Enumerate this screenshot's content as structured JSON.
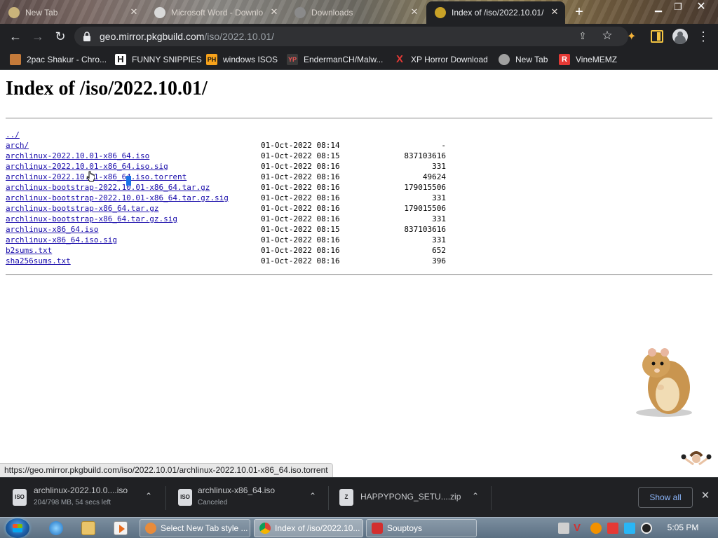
{
  "tabs": [
    {
      "title": "New Tab"
    },
    {
      "title": "Microsoft Word - Downlo"
    },
    {
      "title": "Downloads"
    },
    {
      "title": "Index of /iso/2022.10.01/"
    }
  ],
  "toolbar": {
    "url_host": "geo.mirror.pkgbuild.com",
    "url_path": "/iso/2022.10.01/"
  },
  "bookmarks": [
    {
      "label": "2pac Shakur - Chro...",
      "icon_text": ""
    },
    {
      "label": "FUNNY SNIPPIES",
      "icon_text": "H"
    },
    {
      "label": "windows ISOS",
      "icon_text": "PH"
    },
    {
      "label": "EndermanCH/Malw...",
      "icon_text": "YP"
    },
    {
      "label": "XP Horror Download",
      "icon_text": "X"
    },
    {
      "label": "New Tab",
      "icon_text": ""
    },
    {
      "label": "VineMEMZ",
      "icon_text": "R"
    }
  ],
  "page": {
    "title": "Index of /iso/2022.10.01/",
    "files": [
      {
        "name": "../",
        "date": "",
        "size": ""
      },
      {
        "name": "arch/",
        "date": "01-Oct-2022 08:14",
        "size": "-"
      },
      {
        "name": "archlinux-2022.10.01-x86_64.iso",
        "date": "01-Oct-2022 08:15",
        "size": "837103616"
      },
      {
        "name": "archlinux-2022.10.01-x86_64.iso.sig",
        "date": "01-Oct-2022 08:16",
        "size": "331"
      },
      {
        "name": "archlinux-2022.10.01-x86_64.iso.torrent",
        "date": "01-Oct-2022 08:16",
        "size": "49624"
      },
      {
        "name": "archlinux-bootstrap-2022.10.01-x86_64.tar.gz",
        "date": "01-Oct-2022 08:16",
        "size": "179015506"
      },
      {
        "name": "archlinux-bootstrap-2022.10.01-x86_64.tar.gz.sig",
        "date": "01-Oct-2022 08:16",
        "size": "331"
      },
      {
        "name": "archlinux-bootstrap-x86_64.tar.gz",
        "date": "01-Oct-2022 08:16",
        "size": "179015506"
      },
      {
        "name": "archlinux-bootstrap-x86_64.tar.gz.sig",
        "date": "01-Oct-2022 08:16",
        "size": "331"
      },
      {
        "name": "archlinux-x86_64.iso",
        "date": "01-Oct-2022 08:15",
        "size": "837103616"
      },
      {
        "name": "archlinux-x86_64.iso.sig",
        "date": "01-Oct-2022 08:16",
        "size": "331"
      },
      {
        "name": "b2sums.txt",
        "date": "01-Oct-2022 08:16",
        "size": "652"
      },
      {
        "name": "sha256sums.txt",
        "date": "01-Oct-2022 08:16",
        "size": "396"
      }
    ]
  },
  "status_url": "https://geo.mirror.pkgbuild.com/iso/2022.10.01/archlinux-2022.10.01-x86_64.iso.torrent",
  "downloads": [
    {
      "name": "archlinux-2022.10.0....iso",
      "status": "204/798 MB, 54 secs left",
      "icon_text": "ISO"
    },
    {
      "name": "archlinux-x86_64.iso",
      "status": "Canceled",
      "icon_text": "ISO"
    },
    {
      "name": "HAPPYPONG_SETU....zip",
      "status": "",
      "icon_text": "Z"
    }
  ],
  "show_all_label": "Show all",
  "taskbar": {
    "tasks": [
      {
        "title": "Select New Tab style ..."
      },
      {
        "title": "Index of /iso/2022.10..."
      },
      {
        "title": "Souptoys"
      }
    ],
    "clock": "5:05 PM"
  },
  "colors": {
    "link": "#1a0dab",
    "chrome_dark": "#202124",
    "show_all_text": "#8ab4f8",
    "selection": "#1a73e8"
  }
}
